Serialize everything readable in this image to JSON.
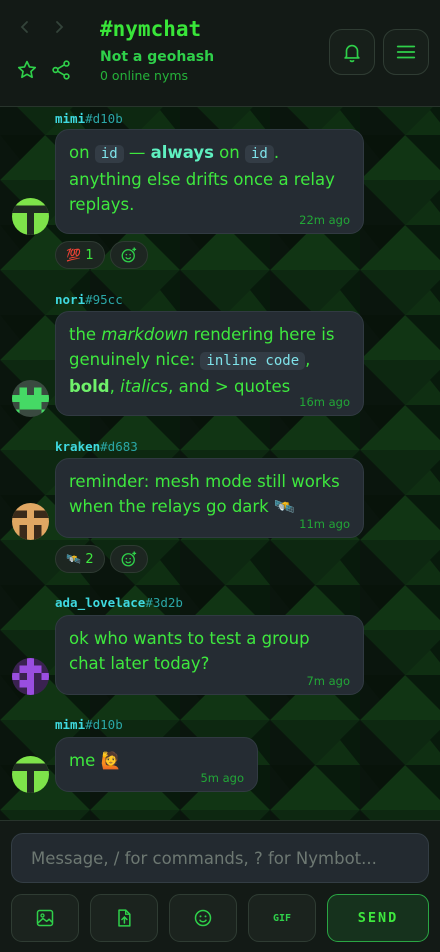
{
  "header": {
    "channel_title": "#nymchat",
    "subtitle": "Not a geohash",
    "online_status": "0 online nyms"
  },
  "messages": [
    {
      "author": "mimi",
      "hash": "#d10b",
      "parts": {
        "on1": "on",
        "code1": "id",
        "dash": "—",
        "always": "always",
        "on2": "on",
        "code2": "id",
        "rest": ". anything else drifts once a relay replays."
      },
      "time": "22m ago",
      "reaction": {
        "emoji": "💯",
        "count": "1"
      }
    },
    {
      "author": "nori",
      "hash": "#95cc",
      "parts": {
        "p1": "the",
        "markdown": "markdown",
        "p2": "rendering here is genuinely nice:",
        "code": "inline code",
        "comma1": ",",
        "bold": "bold",
        "comma2": ",",
        "italics": "italics",
        "p3": ", and > quotes"
      },
      "time": "16m ago"
    },
    {
      "author": "kraken",
      "hash": "#d683",
      "text": "reminder: mesh mode still works when the relays go dark 🛰️",
      "time": "11m ago",
      "reaction": {
        "emoji": "🛰️",
        "count": "2"
      }
    },
    {
      "author": "ada_lovelace",
      "hash": "#3d2b",
      "text": "ok who wants to test a group chat later today?",
      "time": "7m ago"
    },
    {
      "author": "mimi",
      "hash": "#d10b",
      "text": "me 🙋",
      "time": "5m ago"
    }
  ],
  "composer": {
    "placeholder": "Message, / for commands, ? for Nymbot...",
    "gif_label": "GIF",
    "send_label": "SEND"
  },
  "colors": {
    "accent": "#39e639",
    "author": "#3fd9e0",
    "bubble": "#252c33",
    "header_bg": "#131a16"
  }
}
